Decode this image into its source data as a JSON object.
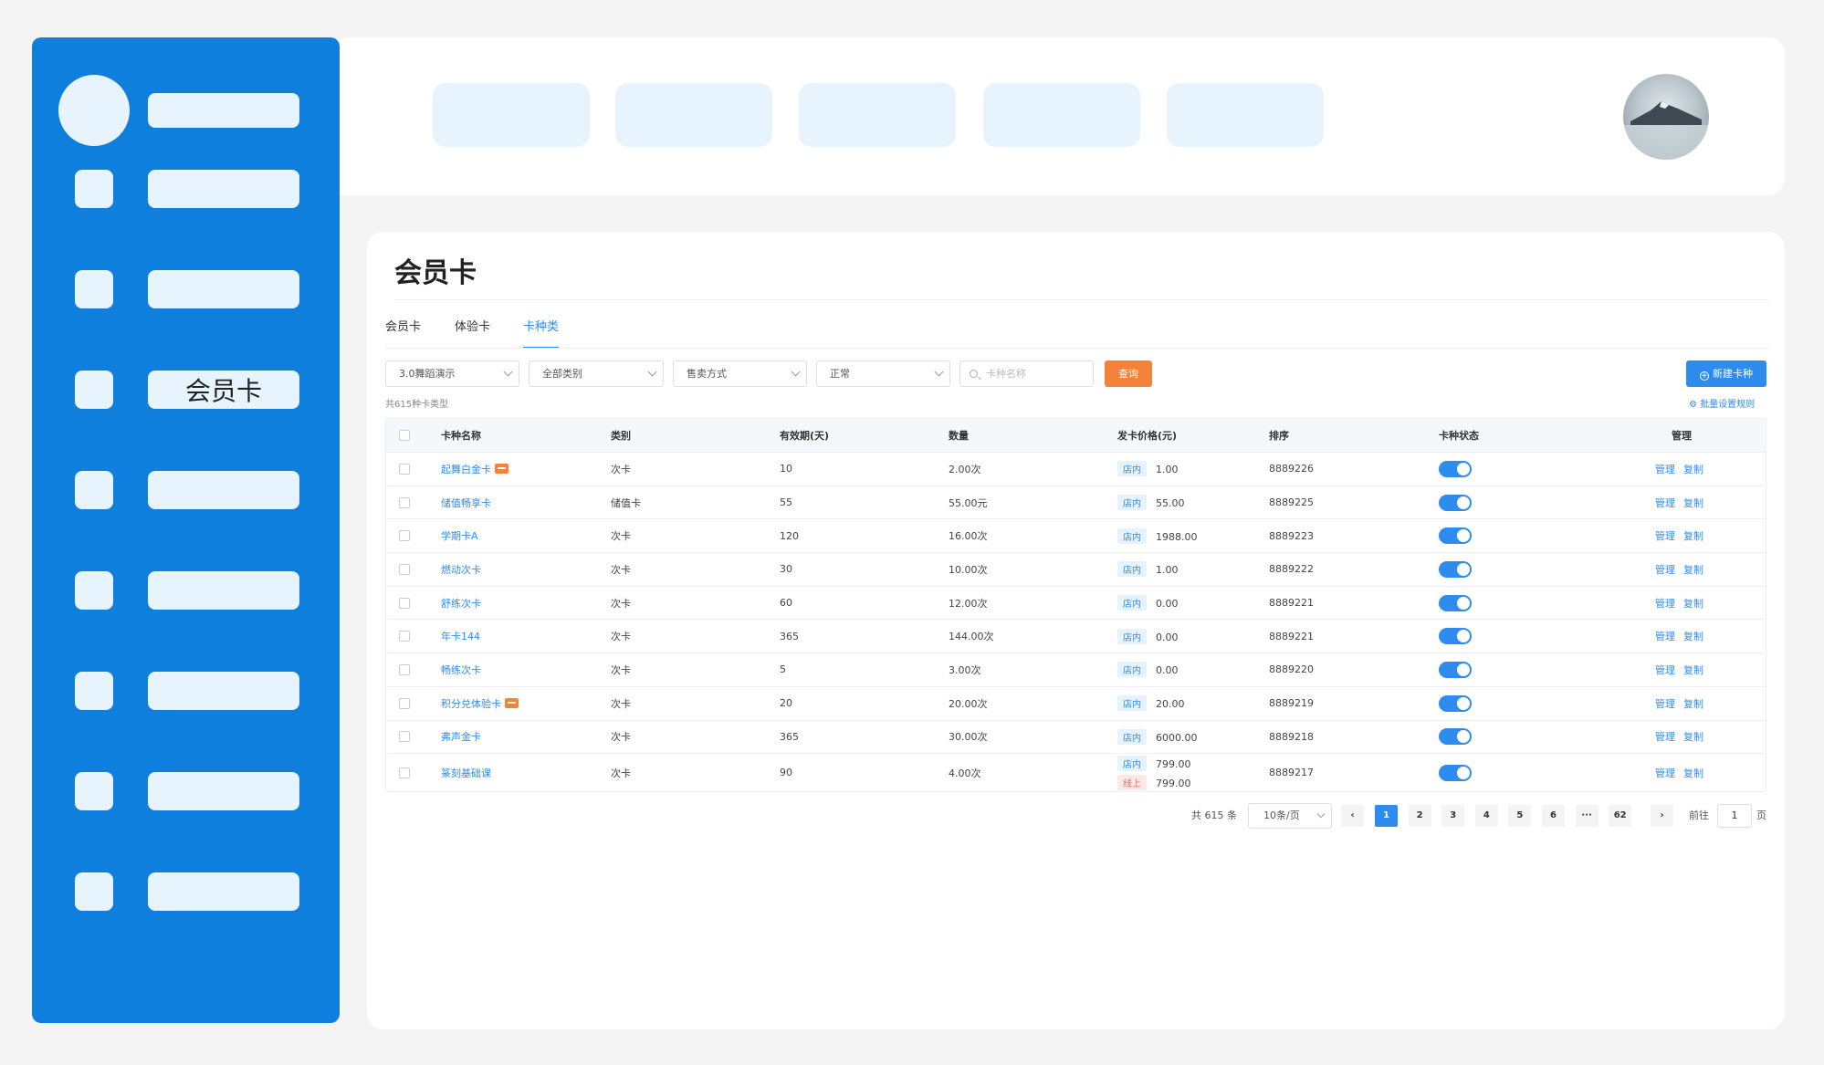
{
  "sidebar": {
    "items": [
      {
        "label": ""
      },
      {
        "label": ""
      },
      {
        "label": "会员卡"
      },
      {
        "label": ""
      },
      {
        "label": ""
      },
      {
        "label": ""
      },
      {
        "label": ""
      },
      {
        "label": ""
      }
    ]
  },
  "page": {
    "title": "会员卡",
    "tabs": [
      {
        "label": "会员卡",
        "active": false
      },
      {
        "label": "体验卡",
        "active": false
      },
      {
        "label": "卡种类",
        "active": true
      }
    ]
  },
  "filters": {
    "studio": "3.0舞蹈演示",
    "category": "全部类别",
    "sale_method": "售卖方式",
    "status": "正常",
    "search_placeholder": "卡种名称",
    "query_label": "查询",
    "new_label": "新建卡种"
  },
  "summary": {
    "count_text": "共615种卡类型",
    "batch_label": "批量设置规则"
  },
  "table": {
    "columns": [
      "卡种名称",
      "类别",
      "有效期(天)",
      "数量",
      "发卡价格(元)",
      "排序",
      "卡种状态",
      "管理"
    ],
    "rows": [
      {
        "name": "起舞白金卡",
        "hot": true,
        "category": "次卡",
        "validity": "10",
        "quantity": "2.00次",
        "prices": [
          {
            "channel": "店内",
            "price": "1.00"
          }
        ],
        "sort": "8889226",
        "enabled": true
      },
      {
        "name": "储值畅享卡",
        "hot": false,
        "category": "储值卡",
        "validity": "55",
        "quantity": "55.00元",
        "prices": [
          {
            "channel": "店内",
            "price": "55.00"
          }
        ],
        "sort": "8889225",
        "enabled": true
      },
      {
        "name": "学期卡A",
        "hot": false,
        "category": "次卡",
        "validity": "120",
        "quantity": "16.00次",
        "prices": [
          {
            "channel": "店内",
            "price": "1988.00"
          }
        ],
        "sort": "8889223",
        "enabled": true
      },
      {
        "name": "燃动次卡",
        "hot": false,
        "category": "次卡",
        "validity": "30",
        "quantity": "10.00次",
        "prices": [
          {
            "channel": "店内",
            "price": "1.00"
          }
        ],
        "sort": "8889222",
        "enabled": true
      },
      {
        "name": "舒练次卡",
        "hot": false,
        "category": "次卡",
        "validity": "60",
        "quantity": "12.00次",
        "prices": [
          {
            "channel": "店内",
            "price": "0.00"
          }
        ],
        "sort": "8889221",
        "enabled": true
      },
      {
        "name": "年卡144",
        "hot": false,
        "category": "次卡",
        "validity": "365",
        "quantity": "144.00次",
        "prices": [
          {
            "channel": "店内",
            "price": "0.00"
          }
        ],
        "sort": "8889221",
        "enabled": true
      },
      {
        "name": "畅练次卡",
        "hot": false,
        "category": "次卡",
        "validity": "5",
        "quantity": "3.00次",
        "prices": [
          {
            "channel": "店内",
            "price": "0.00"
          }
        ],
        "sort": "8889220",
        "enabled": true
      },
      {
        "name": "积分兑体验卡",
        "hot": true,
        "category": "次卡",
        "validity": "20",
        "quantity": "20.00次",
        "prices": [
          {
            "channel": "店内",
            "price": "20.00"
          }
        ],
        "sort": "8889219",
        "enabled": true
      },
      {
        "name": "弗声金卡",
        "hot": false,
        "category": "次卡",
        "validity": "365",
        "quantity": "30.00次",
        "prices": [
          {
            "channel": "店内",
            "price": "6000.00"
          }
        ],
        "sort": "8889218",
        "enabled": true
      },
      {
        "name": "篆刻基础课",
        "hot": false,
        "category": "次卡",
        "validity": "90",
        "quantity": "4.00次",
        "prices": [
          {
            "channel": "店内",
            "price": "799.00"
          },
          {
            "channel": "线上",
            "price": "799.00"
          }
        ],
        "sort": "8889217",
        "enabled": true
      }
    ],
    "ops": {
      "manage": "管理",
      "copy": "复制"
    }
  },
  "pagination": {
    "total_text": "共 615 条",
    "page_size": "10条/页",
    "pages": [
      "1",
      "2",
      "3",
      "4",
      "5",
      "6",
      "···",
      "62"
    ],
    "prev": "‹",
    "next": "›",
    "goto_label": "前往",
    "goto_value": "1",
    "page_suffix": "页"
  },
  "colors": {
    "sidebar": "#0f7fdd",
    "accent": "#2f8cef",
    "query_button": "#f5823b"
  }
}
